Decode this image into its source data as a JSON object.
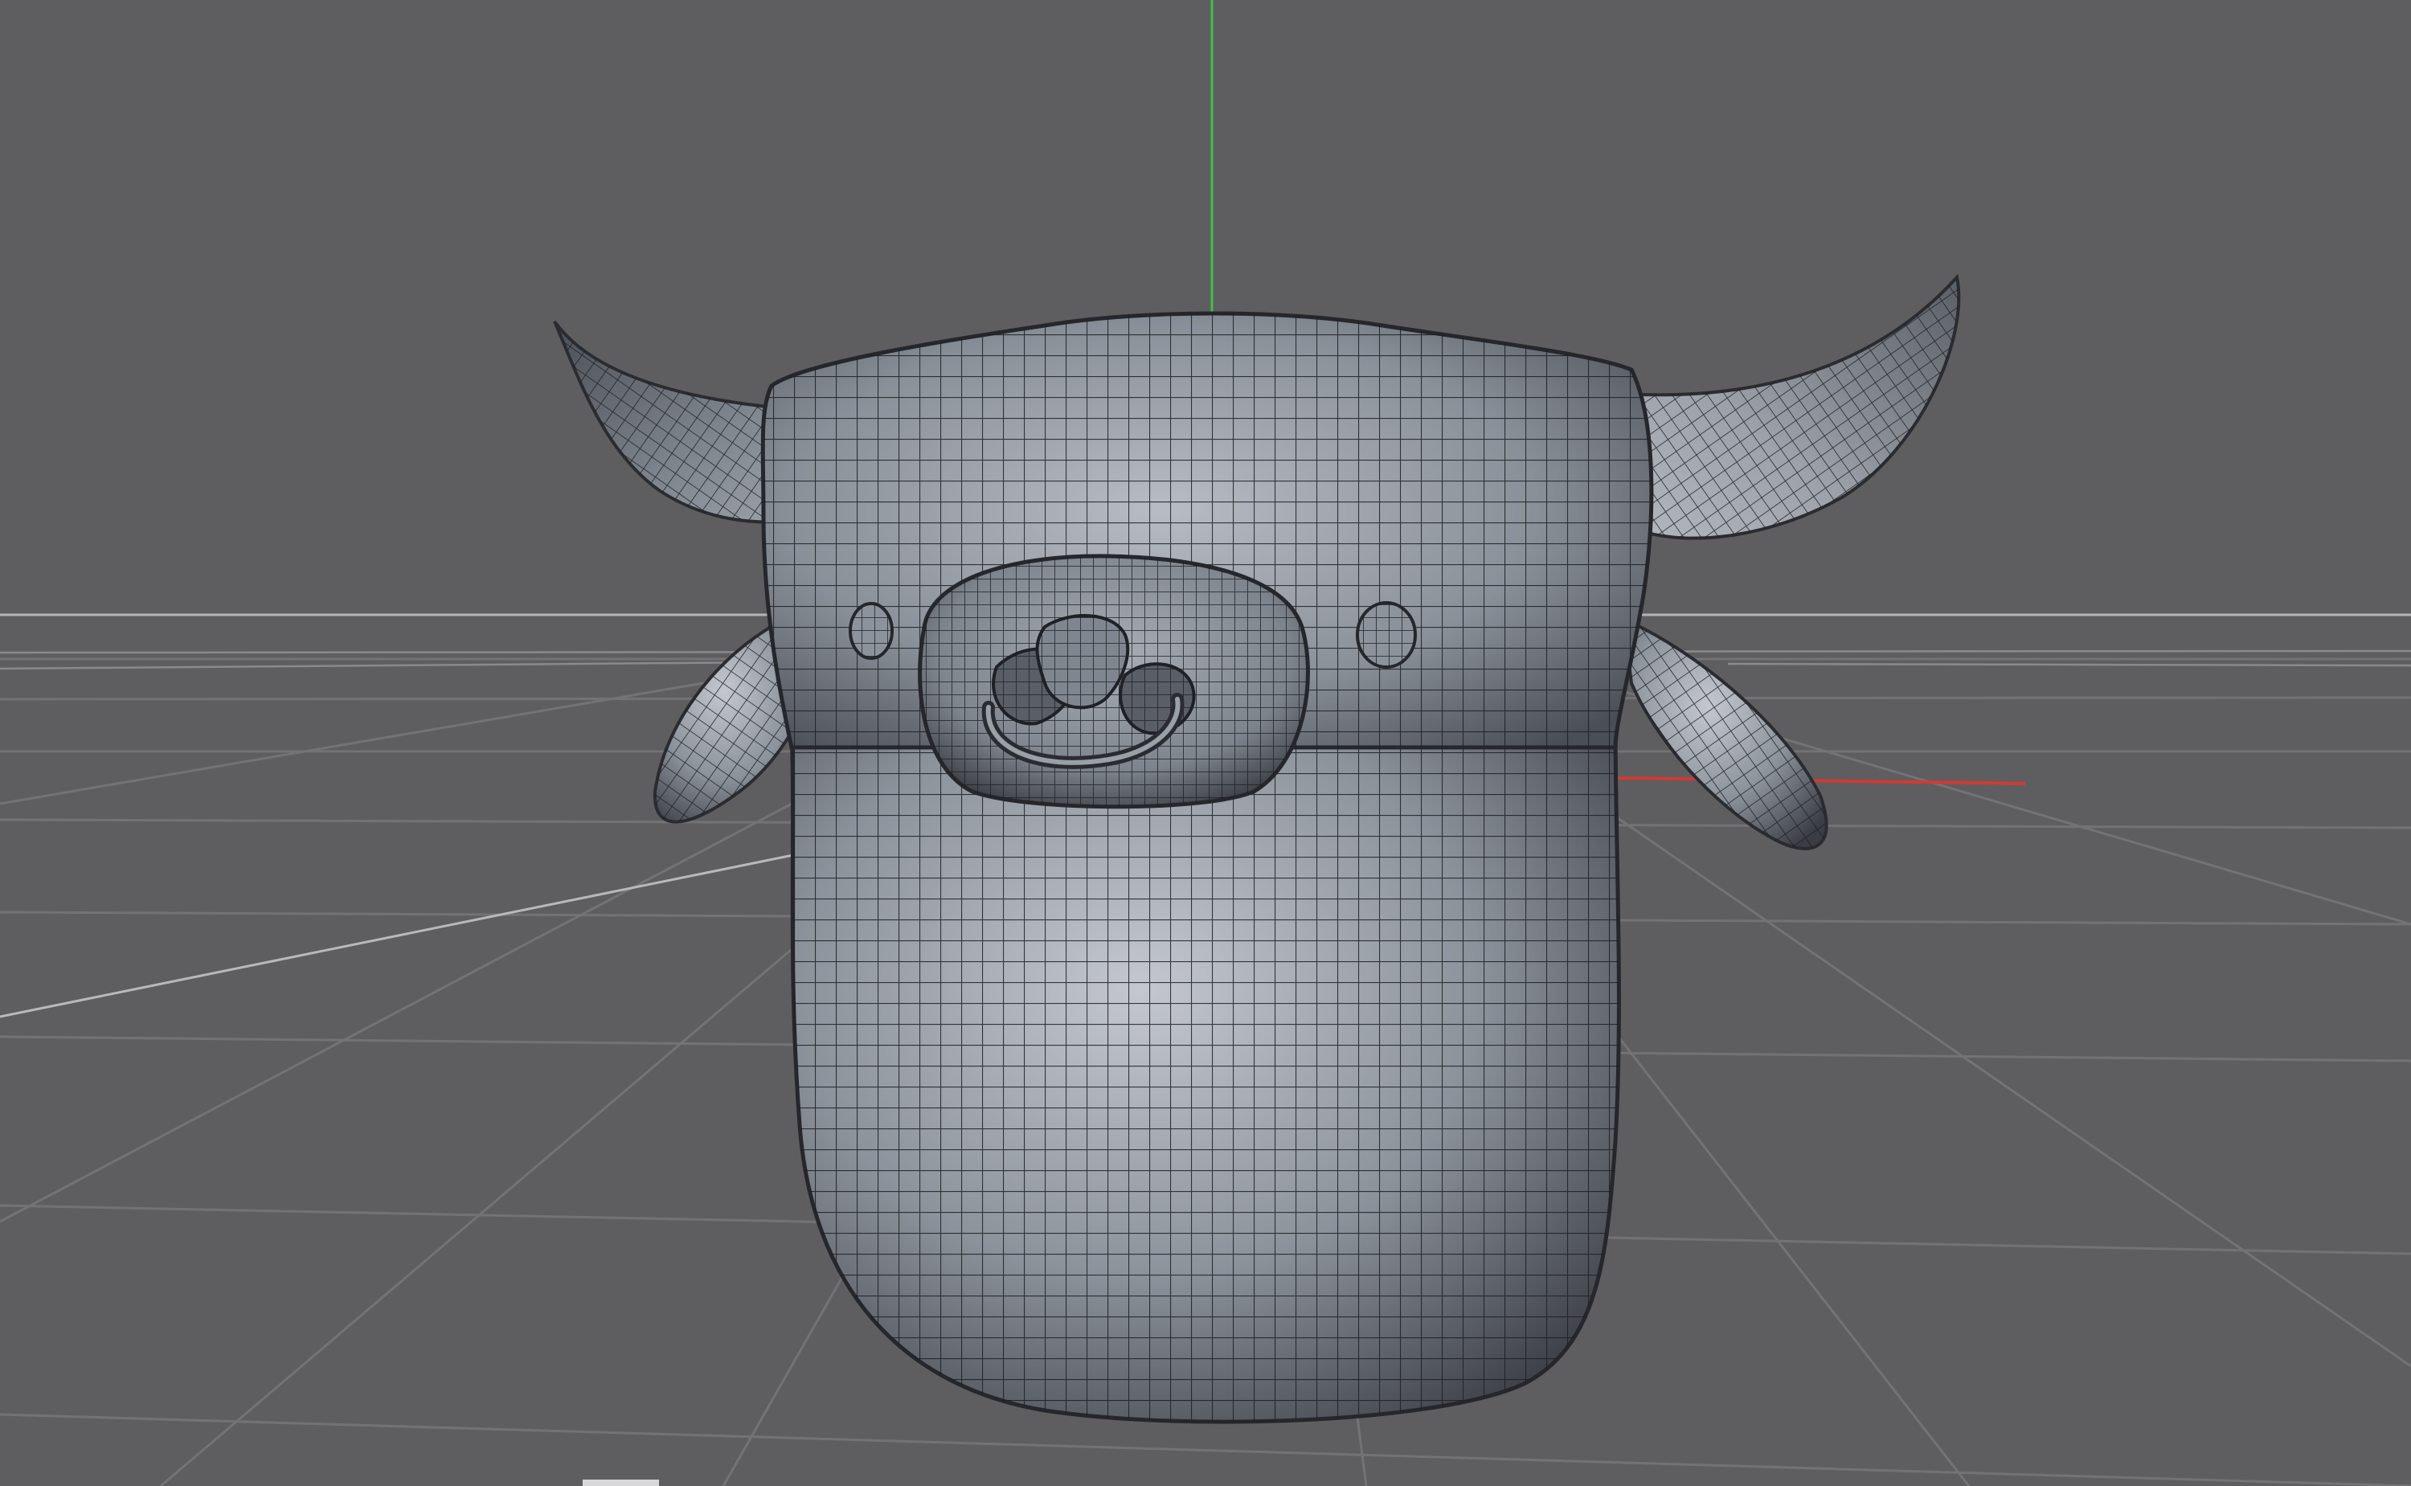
{
  "viewport": {
    "background_color": "#5e5e60",
    "grid_line_color": "#737375",
    "horizon_line_color": "#b4b4b6",
    "y_axis_color": "#3fbf4a",
    "x_axis_color": "#d23a32",
    "model_fill_color": "#9aa0a8",
    "wire_color": "#1c1e22",
    "display_mode": "shaded-wireframe",
    "model_subject": "cartoon-cow-head"
  }
}
